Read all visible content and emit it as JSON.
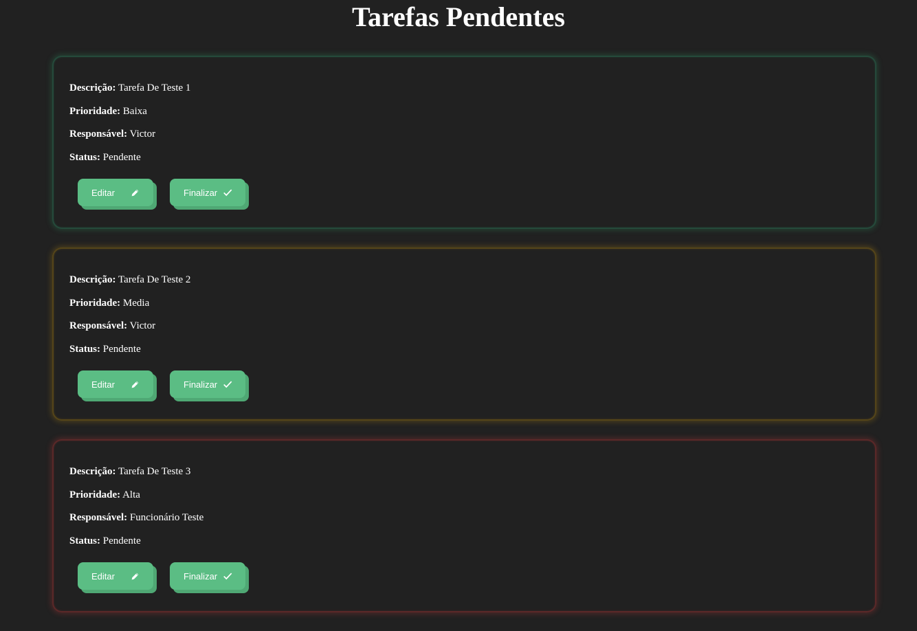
{
  "header": {
    "title": "Tarefas Pendentes"
  },
  "labels": {
    "description": "Descrição:",
    "priority": "Prioridade:",
    "responsible": "Responsável:",
    "status": "Status:"
  },
  "buttons": {
    "edit_label": "Editar",
    "edit_icon": "pencil-icon",
    "finish_label": "Finalizar",
    "finish_icon": "check-icon"
  },
  "colors": {
    "background": "#212121",
    "button": "#5bbd84",
    "low_priority_glow": "#2e9664",
    "medium_priority_glow": "#c89614",
    "high_priority_glow": "#c83c3c"
  },
  "tasks": [
    {
      "description": "Tarefa De Teste 1",
      "priority": "Baixa",
      "responsible": "Victor",
      "status": "Pendente"
    },
    {
      "description": "Tarefa De Teste 2",
      "priority": "Media",
      "responsible": "Victor",
      "status": "Pendente"
    },
    {
      "description": "Tarefa De Teste 3",
      "priority": "Alta",
      "responsible": "Funcionário Teste",
      "status": "Pendente"
    }
  ]
}
